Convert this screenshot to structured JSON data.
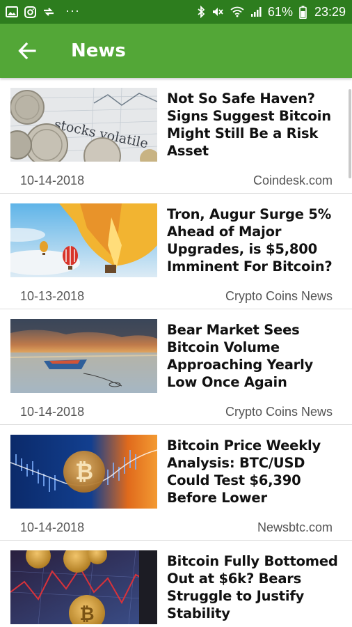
{
  "status_bar": {
    "icons_left": [
      "gallery-icon",
      "instagram-icon",
      "sync-icon"
    ],
    "more_indicator": "···",
    "icons_right": [
      "bluetooth-icon",
      "mute-icon",
      "wifi-icon",
      "signal-icon"
    ],
    "battery": "61%",
    "time": "23:29"
  },
  "app_bar": {
    "title": "News",
    "back_icon": "arrow-back-icon",
    "background": "#53a737"
  },
  "articles": [
    {
      "headline": "Not So Safe Haven? Signs Suggest Bitcoin Might Still Be a Risk Asset",
      "date": "10-14-2018",
      "source": "Coindesk.com",
      "thumb_text": "stocks volatile"
    },
    {
      "headline": "Tron, Augur Surge 5% Ahead of Major Upgrades, is $5,800 Imminent For Bitcoin?",
      "date": "10-13-2018",
      "source": "Crypto Coins News"
    },
    {
      "headline": "Bear Market Sees Bitcoin Volume Approaching Yearly Low Once Again",
      "date": "10-14-2018",
      "source": "Crypto Coins News"
    },
    {
      "headline": "Bitcoin Price Weekly Analysis: BTC/USD Could Test $6,390 Before Lower",
      "date": "10-14-2018",
      "source": "Newsbtc.com"
    },
    {
      "headline": "Bitcoin Fully Bottomed Out at $6k? Bears Struggle to Justify Stability",
      "date": "",
      "source": ""
    }
  ]
}
